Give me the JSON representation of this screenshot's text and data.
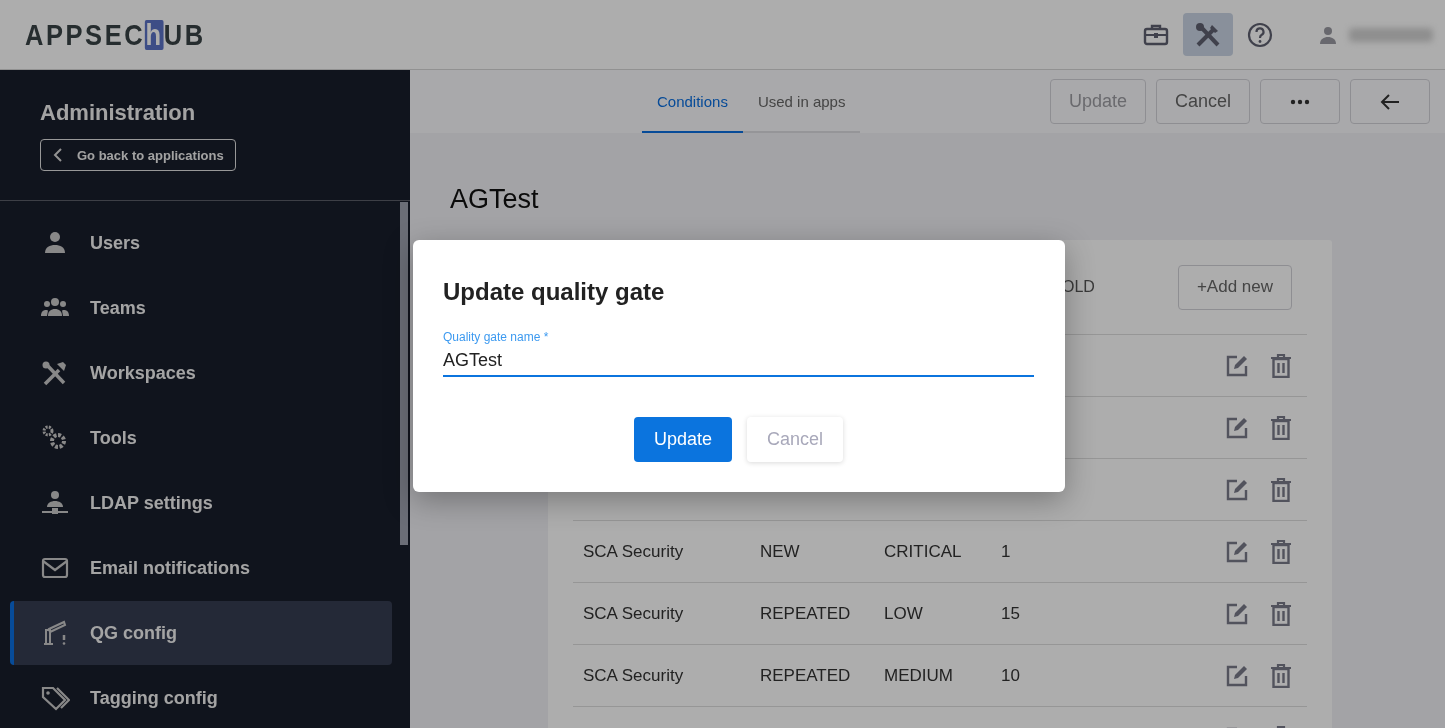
{
  "topbar": {
    "logo": {
      "before": "APPSEC",
      "boxed": "h",
      "after": "UB"
    },
    "icons": [
      {
        "kind": "briefcase",
        "selected": false
      },
      {
        "kind": "tools",
        "selected": true
      },
      {
        "kind": "help",
        "selected": false
      }
    ]
  },
  "sidebar": {
    "title": "Administration",
    "back_button": "Go back to applications",
    "items": [
      {
        "label": "Users",
        "selected": false
      },
      {
        "label": "Teams",
        "selected": false
      },
      {
        "label": "Workspaces",
        "selected": false
      },
      {
        "label": "Tools",
        "selected": false
      },
      {
        "label": "LDAP settings",
        "selected": false
      },
      {
        "label": "Email notifications",
        "selected": false
      },
      {
        "label": "QG config",
        "selected": true
      },
      {
        "label": "Tagging config",
        "selected": false
      }
    ]
  },
  "tabs": [
    {
      "label": "Conditions",
      "selected": true
    },
    {
      "label": "Used in apps",
      "selected": false
    }
  ],
  "actions": [
    {
      "kind": "text",
      "label": "Update",
      "disabled": true
    },
    {
      "kind": "text",
      "label": "Cancel",
      "disabled": false
    },
    {
      "kind": "more"
    },
    {
      "kind": "back"
    }
  ],
  "page_title": "AGTest",
  "table": {
    "header_tail": "OLD",
    "add_button": "+Add new",
    "rows": [
      {},
      {},
      {},
      {
        "cells": [
          "SCA Security",
          "NEW",
          "CRITICAL",
          "1"
        ]
      },
      {
        "cells": [
          "SCA Security",
          "REPEATED",
          "LOW",
          "15"
        ]
      },
      {
        "cells": [
          "SCA Security",
          "REPEATED",
          "MEDIUM",
          "10"
        ]
      },
      {}
    ]
  },
  "dialog": {
    "title": "Update quality gate",
    "field": {
      "label": "Quality gate name *",
      "value": "AGTest"
    },
    "buttons": [
      {
        "kind": "primary",
        "label": "Update"
      },
      {
        "kind": "secondary",
        "label": "Cancel"
      }
    ]
  }
}
